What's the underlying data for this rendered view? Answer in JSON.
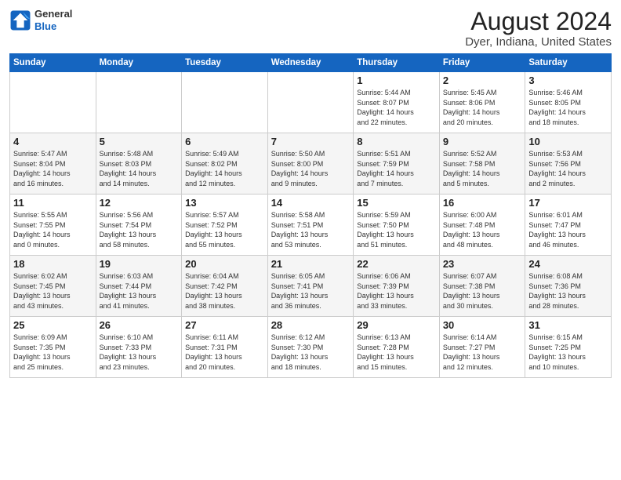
{
  "logo": {
    "line1": "General",
    "line2": "Blue"
  },
  "title": "August 2024",
  "subtitle": "Dyer, Indiana, United States",
  "days_of_week": [
    "Sunday",
    "Monday",
    "Tuesday",
    "Wednesday",
    "Thursday",
    "Friday",
    "Saturday"
  ],
  "weeks": [
    [
      {
        "day": "",
        "content": ""
      },
      {
        "day": "",
        "content": ""
      },
      {
        "day": "",
        "content": ""
      },
      {
        "day": "",
        "content": ""
      },
      {
        "day": "1",
        "content": "Sunrise: 5:44 AM\nSunset: 8:07 PM\nDaylight: 14 hours\nand 22 minutes."
      },
      {
        "day": "2",
        "content": "Sunrise: 5:45 AM\nSunset: 8:06 PM\nDaylight: 14 hours\nand 20 minutes."
      },
      {
        "day": "3",
        "content": "Sunrise: 5:46 AM\nSunset: 8:05 PM\nDaylight: 14 hours\nand 18 minutes."
      }
    ],
    [
      {
        "day": "4",
        "content": "Sunrise: 5:47 AM\nSunset: 8:04 PM\nDaylight: 14 hours\nand 16 minutes."
      },
      {
        "day": "5",
        "content": "Sunrise: 5:48 AM\nSunset: 8:03 PM\nDaylight: 14 hours\nand 14 minutes."
      },
      {
        "day": "6",
        "content": "Sunrise: 5:49 AM\nSunset: 8:02 PM\nDaylight: 14 hours\nand 12 minutes."
      },
      {
        "day": "7",
        "content": "Sunrise: 5:50 AM\nSunset: 8:00 PM\nDaylight: 14 hours\nand 9 minutes."
      },
      {
        "day": "8",
        "content": "Sunrise: 5:51 AM\nSunset: 7:59 PM\nDaylight: 14 hours\nand 7 minutes."
      },
      {
        "day": "9",
        "content": "Sunrise: 5:52 AM\nSunset: 7:58 PM\nDaylight: 14 hours\nand 5 minutes."
      },
      {
        "day": "10",
        "content": "Sunrise: 5:53 AM\nSunset: 7:56 PM\nDaylight: 14 hours\nand 2 minutes."
      }
    ],
    [
      {
        "day": "11",
        "content": "Sunrise: 5:55 AM\nSunset: 7:55 PM\nDaylight: 14 hours\nand 0 minutes."
      },
      {
        "day": "12",
        "content": "Sunrise: 5:56 AM\nSunset: 7:54 PM\nDaylight: 13 hours\nand 58 minutes."
      },
      {
        "day": "13",
        "content": "Sunrise: 5:57 AM\nSunset: 7:52 PM\nDaylight: 13 hours\nand 55 minutes."
      },
      {
        "day": "14",
        "content": "Sunrise: 5:58 AM\nSunset: 7:51 PM\nDaylight: 13 hours\nand 53 minutes."
      },
      {
        "day": "15",
        "content": "Sunrise: 5:59 AM\nSunset: 7:50 PM\nDaylight: 13 hours\nand 51 minutes."
      },
      {
        "day": "16",
        "content": "Sunrise: 6:00 AM\nSunset: 7:48 PM\nDaylight: 13 hours\nand 48 minutes."
      },
      {
        "day": "17",
        "content": "Sunrise: 6:01 AM\nSunset: 7:47 PM\nDaylight: 13 hours\nand 46 minutes."
      }
    ],
    [
      {
        "day": "18",
        "content": "Sunrise: 6:02 AM\nSunset: 7:45 PM\nDaylight: 13 hours\nand 43 minutes."
      },
      {
        "day": "19",
        "content": "Sunrise: 6:03 AM\nSunset: 7:44 PM\nDaylight: 13 hours\nand 41 minutes."
      },
      {
        "day": "20",
        "content": "Sunrise: 6:04 AM\nSunset: 7:42 PM\nDaylight: 13 hours\nand 38 minutes."
      },
      {
        "day": "21",
        "content": "Sunrise: 6:05 AM\nSunset: 7:41 PM\nDaylight: 13 hours\nand 36 minutes."
      },
      {
        "day": "22",
        "content": "Sunrise: 6:06 AM\nSunset: 7:39 PM\nDaylight: 13 hours\nand 33 minutes."
      },
      {
        "day": "23",
        "content": "Sunrise: 6:07 AM\nSunset: 7:38 PM\nDaylight: 13 hours\nand 30 minutes."
      },
      {
        "day": "24",
        "content": "Sunrise: 6:08 AM\nSunset: 7:36 PM\nDaylight: 13 hours\nand 28 minutes."
      }
    ],
    [
      {
        "day": "25",
        "content": "Sunrise: 6:09 AM\nSunset: 7:35 PM\nDaylight: 13 hours\nand 25 minutes."
      },
      {
        "day": "26",
        "content": "Sunrise: 6:10 AM\nSunset: 7:33 PM\nDaylight: 13 hours\nand 23 minutes."
      },
      {
        "day": "27",
        "content": "Sunrise: 6:11 AM\nSunset: 7:31 PM\nDaylight: 13 hours\nand 20 minutes."
      },
      {
        "day": "28",
        "content": "Sunrise: 6:12 AM\nSunset: 7:30 PM\nDaylight: 13 hours\nand 18 minutes."
      },
      {
        "day": "29",
        "content": "Sunrise: 6:13 AM\nSunset: 7:28 PM\nDaylight: 13 hours\nand 15 minutes."
      },
      {
        "day": "30",
        "content": "Sunrise: 6:14 AM\nSunset: 7:27 PM\nDaylight: 13 hours\nand 12 minutes."
      },
      {
        "day": "31",
        "content": "Sunrise: 6:15 AM\nSunset: 7:25 PM\nDaylight: 13 hours\nand 10 minutes."
      }
    ]
  ]
}
